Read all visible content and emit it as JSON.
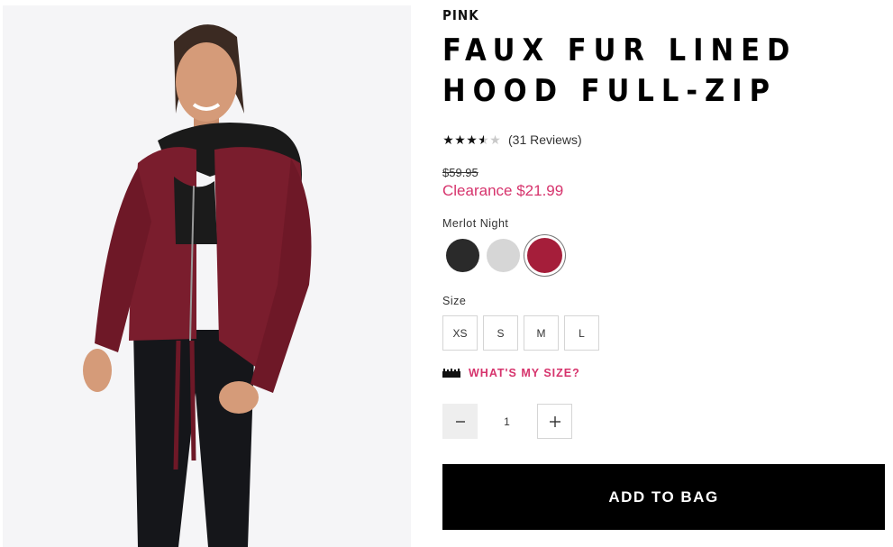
{
  "product": {
    "brand": "PINK",
    "title": "FAUX FUR LINED HOOD FULL-ZIP",
    "image_alt": "Model wearing merlot full-zip hoodie with black leggings"
  },
  "rating": {
    "value": 3.5,
    "max": 5,
    "reviews_label": "(31 Reviews)"
  },
  "price": {
    "original": "$59.95",
    "sale": "Clearance $21.99",
    "sale_color": "#d6336c"
  },
  "color": {
    "selected_label": "Merlot Night",
    "swatches": [
      {
        "name": "black",
        "hex": "#2a2a2a"
      },
      {
        "name": "heather-gray",
        "hex": "#d6d6d6"
      },
      {
        "name": "merlot-night",
        "hex": "#a51e3a",
        "selected": true
      }
    ]
  },
  "size": {
    "label": "Size",
    "options": [
      "XS",
      "S",
      "M",
      "L"
    ]
  },
  "size_guide": {
    "label": "WHAT'S MY SIZE?",
    "icon": "ruler-icon"
  },
  "quantity": {
    "value": "1",
    "minus_icon": "minus-icon",
    "plus_icon": "plus-icon"
  },
  "cta": {
    "add_to_bag": "ADD TO BAG"
  }
}
